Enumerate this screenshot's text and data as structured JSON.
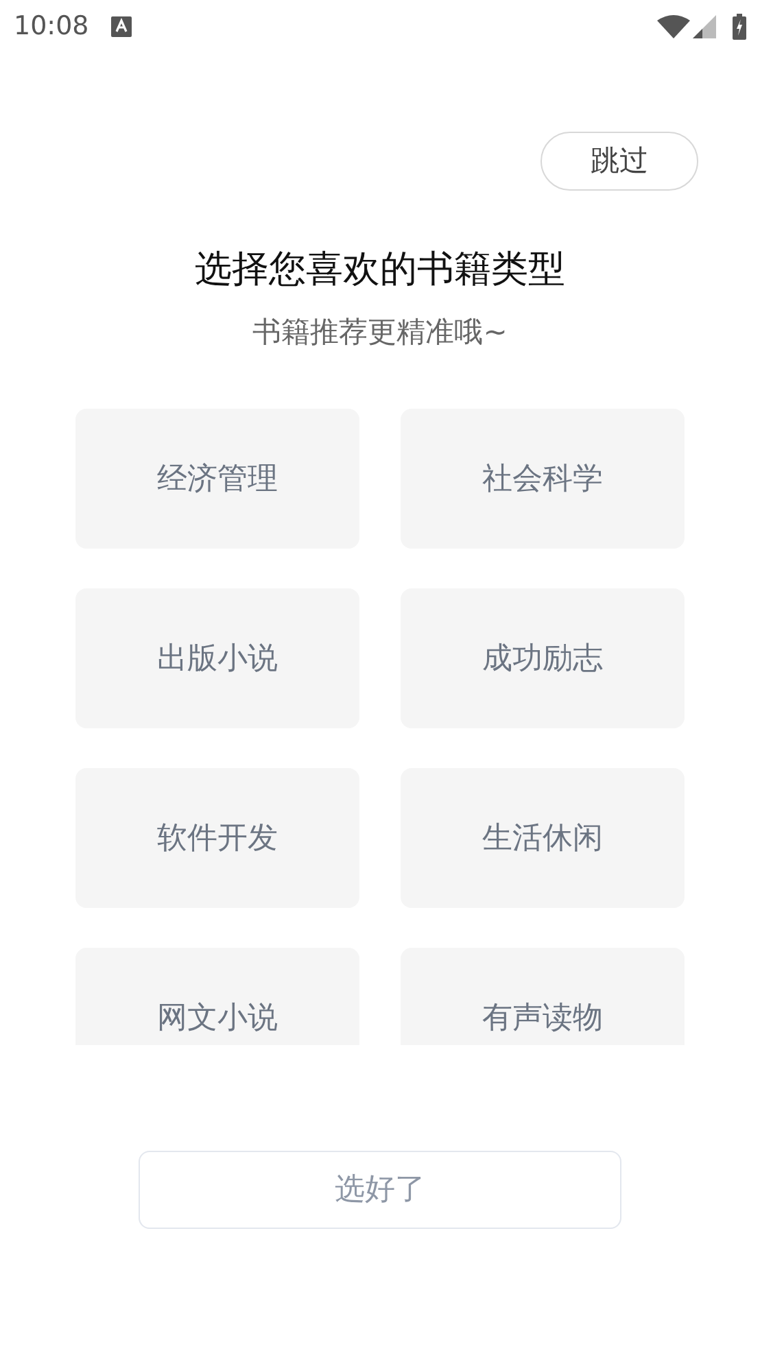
{
  "status_bar": {
    "time": "10:08"
  },
  "skip_button": {
    "label": "跳过"
  },
  "title": "选择您喜欢的书籍类型",
  "subtitle": "书籍推荐更精准哦~",
  "categories": [
    {
      "label": "经济管理",
      "selected": false
    },
    {
      "label": "社会科学",
      "selected": false
    },
    {
      "label": "出版小说",
      "selected": false
    },
    {
      "label": "成功励志",
      "selected": false
    },
    {
      "label": "软件开发",
      "selected": false
    },
    {
      "label": "生活休闲",
      "selected": false
    },
    {
      "label": "网文小说",
      "selected": false
    },
    {
      "label": "有声读物",
      "selected": false
    }
  ],
  "confirm_button": {
    "label": "选好了",
    "disabled": true
  }
}
